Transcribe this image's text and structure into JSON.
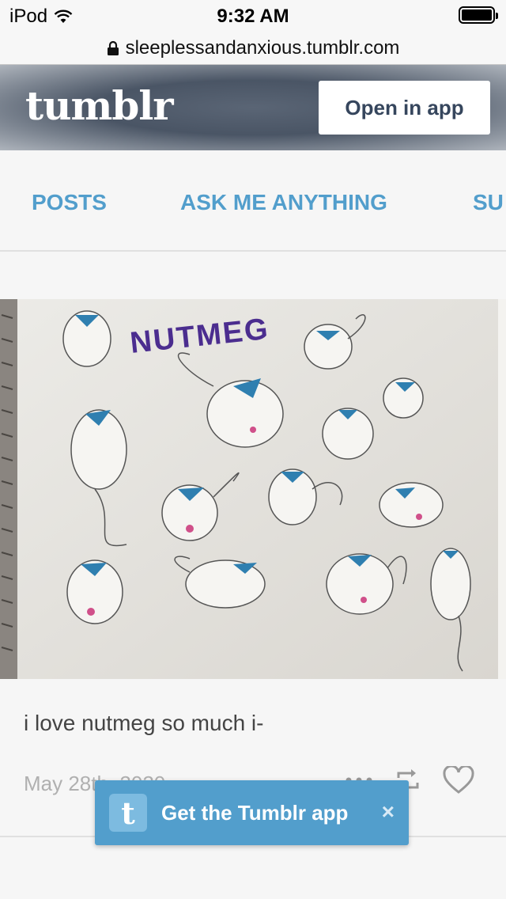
{
  "status_bar": {
    "device": "iPod",
    "time": "9:32 AM"
  },
  "browser": {
    "domain": "sleeplessandanxious.tumblr.com"
  },
  "header": {
    "logo": "tumblr",
    "open_in_app": "Open in app"
  },
  "nav": {
    "items": [
      "POSTS",
      "ASK ME ANYTHING",
      "SU"
    ]
  },
  "post": {
    "image_title": "NUTMEG",
    "caption": "i love nutmeg so much i-",
    "date": "May 28th, 2020"
  },
  "banner": {
    "icon_letter": "t",
    "label": "Get the Tumblr app",
    "close": "×"
  },
  "colors": {
    "accent": "#529ecc",
    "header_dark": "#36465d",
    "ink_blue": "#2f7fb0",
    "title_purple": "#4b2d8f"
  },
  "icons": [
    "wifi-icon",
    "lock-icon",
    "battery-icon",
    "more-icon",
    "reblog-icon",
    "heart-icon",
    "close-icon"
  ]
}
